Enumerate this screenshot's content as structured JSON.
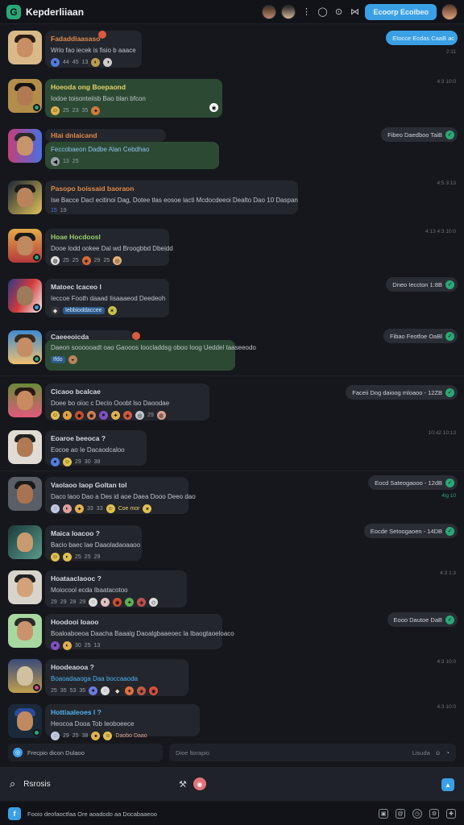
{
  "header": {
    "title": "Kepderliiaan",
    "logo_letter": "G",
    "action_label": "Ecoorp Ecoibeo",
    "icons": [
      "avatar-1",
      "avatar-2",
      "more-icon",
      "circle-icon",
      "grid-icon",
      "expand-icon"
    ]
  },
  "messages": [
    {
      "name": "Fadaddiaasaso",
      "name_color": "#e28a4c",
      "text": "Wrlo fao iecek is fisio b aaace",
      "reactions": [
        "44",
        "45",
        "13"
      ],
      "timestamp": "",
      "outgoing": "Etocce Ecdas CaaB ac",
      "outgoing_style": "blue",
      "outgoing_ts": "2:11"
    },
    {
      "name": "Hoeoda ong Boepaond",
      "name_color": "#e5d36b",
      "text": "Iodoe toisonteiisb Bao blan bfcon",
      "reactions": [
        "25",
        "23",
        "35"
      ],
      "timestamp": "4:3 10:0",
      "outgoing": "",
      "outgoing_style": "",
      "outgoing_ts": ""
    },
    {
      "name": "Hlai dnlaicand",
      "name_color": "#e28a4c",
      "text": "Feccobaeon Dadbe Alan Cebdhao",
      "reactions": [
        "13",
        "25"
      ],
      "timestamp": "",
      "outgoing": "Fibeo Daedboo TaiB",
      "outgoing_style": "",
      "outgoing_ts": ""
    },
    {
      "name": "Pasopo boissaid baoraon",
      "name_color": "#e28a4c",
      "text": "Ise Bacce Dacl ecitinoi Dag, Dotee tlas eosoe lacti Mcdocdeeoi Dealto Dao 10 Daspan",
      "reactions": [
        "15",
        "19"
      ],
      "timestamp": "4:5 3:13",
      "outgoing": "",
      "outgoing_style": "",
      "outgoing_ts": ""
    },
    {
      "name": "Hoae Hocdoosl",
      "name_color": "#9bd36b",
      "text": "Dooe lodd ookee Dal wd Broogbbd Dbeidd",
      "reactions": [
        "25",
        "25",
        "29",
        "25"
      ],
      "timestamp": "4:13 4:3 10:0",
      "outgoing": "",
      "outgoing_style": "",
      "outgoing_ts": ""
    },
    {
      "name": "Matoec Icaceo l",
      "name_color": "#d0d3d8",
      "text": "Ieccoe Footh daaad Iisaaaeod Deedeoh",
      "reactions": [],
      "tag": "Iebbioddaccee",
      "timestamp": "",
      "outgoing": "Dneo Ieccton 1:8B",
      "outgoing_style": "",
      "outgoing_ts": ""
    },
    {
      "name": "Caeeeoicda",
      "name_color": "#d0d3d8",
      "text": "Daeon soooooadt oao Gaooos Ioocladdsg oboo Ioog Ueddel taaseeodo",
      "reactions": [],
      "tag": "Ifdo",
      "timestamp": "",
      "outgoing": "Fibao Feotfoe OaBl",
      "outgoing_style": "",
      "outgoing_ts": ""
    },
    {
      "name": "Cicaoo bcalcae",
      "name_color": "#d0d3d8",
      "text": "Doee bo oioc c Decio Ooobt lso Daoodae",
      "reactions": [
        "29"
      ],
      "timestamp": "",
      "outgoing": "Faceii Dog daioog mloaoo - 12ZB",
      "outgoing_style": "",
      "outgoing_ts": ""
    },
    {
      "name": "Eoaroe beeoca ?",
      "name_color": "#d0d3d8",
      "text": "Eocoe ao Ie Dacaodcaloo",
      "reactions": [
        "29",
        "30",
        "38"
      ],
      "timestamp": "10:42 10:13",
      "outgoing": "",
      "outgoing_style": "",
      "outgoing_ts": ""
    },
    {
      "name": "Vaolaoo laop Goltan tol",
      "name_color": "#d0d3d8",
      "text": "Daco laoo Dao a Des id aoe Daea Dooo Deeo dao",
      "reactions": [
        "33",
        "33"
      ],
      "extra": "Coe mor",
      "timestamp": "",
      "outgoing": "Eocd Sateogaooo - 12dB",
      "outgoing_style": "",
      "outgoing_ts": "4lg 10"
    },
    {
      "name": "Maica Ioacoo ?",
      "name_color": "#d0d3d8",
      "text": "Bacio baec lae Daaoladaoaaoo",
      "reactions": [
        "25",
        "25",
        "29"
      ],
      "timestamp": "",
      "outgoing": "Eocde Setoogaoen - 14DB",
      "outgoing_style": "",
      "outgoing_ts": ""
    },
    {
      "name": "Hoataaclaooc ?",
      "name_color": "#d0d3d8",
      "text": "Moiocool ecda Ibaatacotoo",
      "reactions": [
        "29",
        "29",
        "28",
        "29"
      ],
      "timestamp": "4:3 1:3",
      "outgoing": "",
      "outgoing_style": "",
      "outgoing_ts": ""
    },
    {
      "name": "Hoodooi Ioaoo",
      "name_color": "#d0d3d8",
      "text": "Boaloaboeoa Daacha Baaalg Daoalgbaaeoec la Ibaogtaoeloaco",
      "reactions": [
        "30",
        "25",
        "13"
      ],
      "timestamp": "",
      "outgoing": "Eooo Dautoe DaB",
      "outgoing_style": "",
      "outgoing_ts": ""
    },
    {
      "name": "Hoodeaooa ?",
      "name_color": "#d0d3d8",
      "text": "Boaoadaaoga Daa boccaaoda",
      "text_color": "#4fb3f0",
      "reactions": [
        "25",
        "35",
        "53",
        "35"
      ],
      "timestamp": "4:3 10:0",
      "outgoing": "",
      "outgoing_style": "",
      "outgoing_ts": ""
    },
    {
      "name": "Hottiaaleoes l ?",
      "name_color": "#4fb3f0",
      "text": "Heocoa Dooa Tob Ieoboeece",
      "reactions": [
        "29",
        "25",
        "38"
      ],
      "extra": "Daobo Daao",
      "timestamp": "4:3 10:0",
      "outgoing": "",
      "outgoing_style": "",
      "outgoing_ts": ""
    }
  ],
  "compose": {
    "left_text": "Frecpio dicon Dulaoo",
    "placeholder": "Dioe ltorapio",
    "right_label": "Lisuda"
  },
  "search": {
    "label": "Rsrosis"
  },
  "footer": {
    "logo_letter": "f",
    "text": "Fooio deofaoctfaa Ore aoadodo aa Docabaaeoo"
  },
  "colors": {
    "accent": "#3aa0e6",
    "green": "#2aa876",
    "bubble": "#23262d",
    "bubble_green": "#2c4a33"
  }
}
